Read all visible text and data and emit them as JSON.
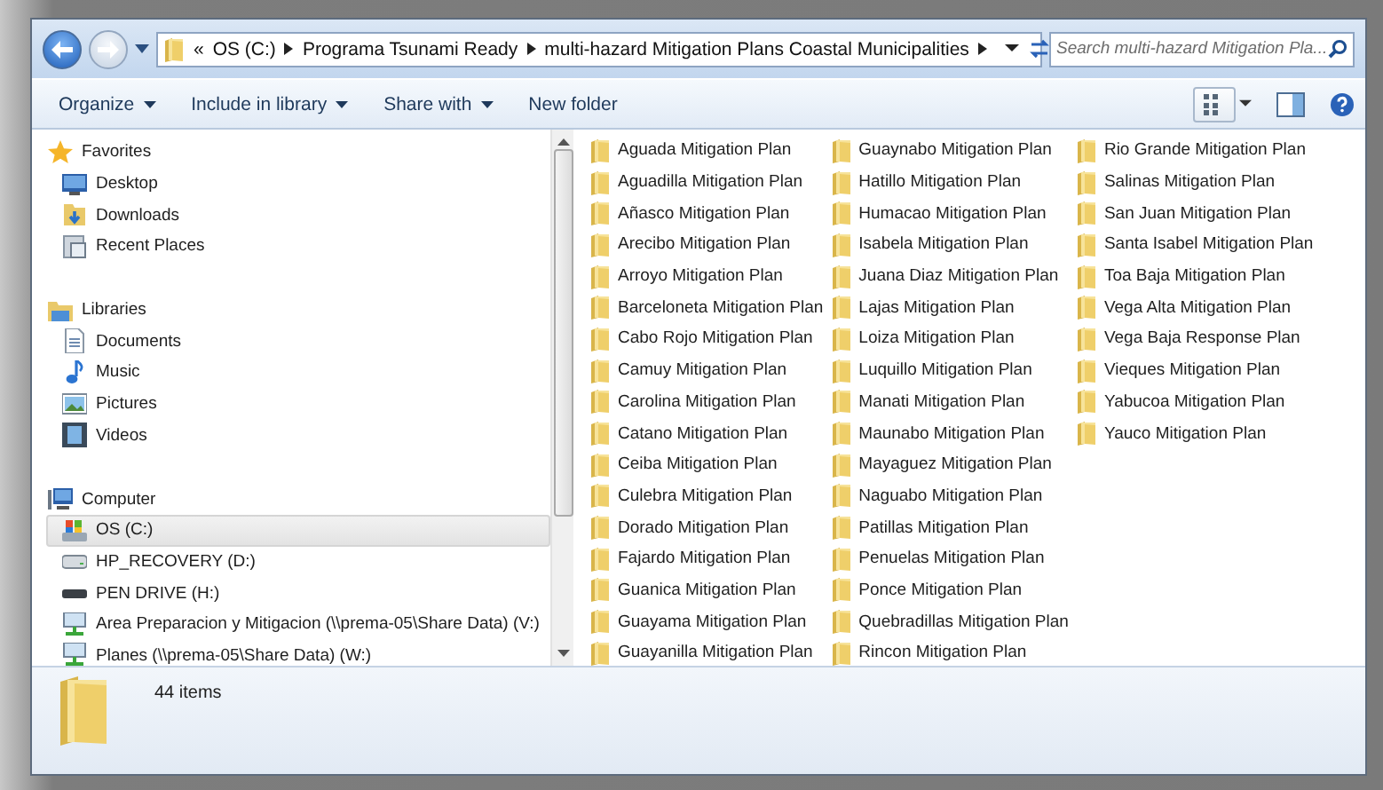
{
  "window": {
    "address": {
      "overflow": "«",
      "segments": [
        "OS (C:)",
        "Programa Tsunami Ready",
        "multi-hazard Mitigation Plans Coastal Municipalities"
      ]
    },
    "search": {
      "placeholder": "Search multi-hazard Mitigation Pla..."
    }
  },
  "toolbar": [
    {
      "label": "Organize",
      "dropdown": true
    },
    {
      "label": "Include in library",
      "dropdown": true
    },
    {
      "label": "Share with",
      "dropdown": true
    },
    {
      "label": "New folder",
      "dropdown": false
    }
  ],
  "navigation": [
    {
      "label": "Favorites",
      "kind": "star",
      "selected": false,
      "children": [
        {
          "label": "Desktop",
          "kind": "desktop",
          "selected": false
        },
        {
          "label": "Downloads",
          "kind": "downloads",
          "selected": false
        },
        {
          "label": "Recent Places",
          "kind": "recent",
          "selected": false
        }
      ]
    },
    {
      "label": "Libraries",
      "kind": "library",
      "selected": false,
      "children": [
        {
          "label": "Documents",
          "kind": "documents",
          "selected": false
        },
        {
          "label": "Music",
          "kind": "music",
          "selected": false
        },
        {
          "label": "Pictures",
          "kind": "pictures",
          "selected": false
        },
        {
          "label": "Videos",
          "kind": "videos",
          "selected": false
        }
      ]
    },
    {
      "label": "Computer",
      "kind": "computer",
      "selected": false,
      "children": [
        {
          "label": "OS (C:)",
          "kind": "os-drive",
          "selected": true
        },
        {
          "label": "HP_RECOVERY (D:)",
          "kind": "drive",
          "selected": false
        },
        {
          "label": "PEN DRIVE (H:)",
          "kind": "usb",
          "selected": false
        },
        {
          "label": "Area Preparacion y Mitigacion (\\\\prema-05\\Share Data) (V:)",
          "kind": "network",
          "selected": false
        },
        {
          "label": "Planes (\\\\prema-05\\Share Data) (W:)",
          "kind": "network",
          "selected": false
        }
      ]
    }
  ],
  "files": [
    "Aguada Mitigation Plan",
    "Aguadilla Mitigation Plan",
    "Añasco Mitigation Plan",
    "Arecibo Mitigation Plan",
    "Arroyo Mitigation Plan",
    "Barceloneta Mitigation Plan",
    "Cabo Rojo Mitigation Plan",
    "Camuy Mitigation Plan",
    "Carolina Mitigation Plan",
    "Catano Mitigation Plan",
    "Ceiba Mitigation Plan",
    "Culebra Mitigation Plan",
    "Dorado Mitigation Plan",
    "Fajardo Mitigation Plan",
    "Guanica Mitigation Plan",
    "Guayama Mitigation Plan",
    "Guayanilla Mitigation Plan",
    "Guaynabo Mitigation Plan",
    "Hatillo Mitigation Plan",
    "Humacao Mitigation Plan",
    "Isabela Mitigation Plan",
    "Juana Diaz Mitigation Plan",
    "Lajas Mitigation Plan",
    "Loiza Mitigation Plan",
    "Luquillo Mitigation Plan",
    "Manati Mitigation Plan",
    "Maunabo Mitigation Plan",
    "Mayaguez Mitigation Plan",
    "Naguabo Mitigation Plan",
    "Patillas Mitigation Plan",
    "Penuelas Mitigation Plan",
    "Ponce Mitigation Plan",
    "Quebradillas Mitigation Plan",
    "Rincon Mitigation Plan",
    "Rio Grande Mitigation Plan",
    "Salinas Mitigation Plan",
    "San Juan Mitigation Plan",
    "Santa Isabel Mitigation Plan",
    "Toa Baja Mitigation Plan",
    "Vega Alta Mitigation Plan",
    "Vega Baja Response Plan",
    "Vieques Mitigation Plan",
    "Yabucoa Mitigation Plan",
    "Yauco Mitigation Plan"
  ],
  "details": {
    "count": "44 items"
  }
}
